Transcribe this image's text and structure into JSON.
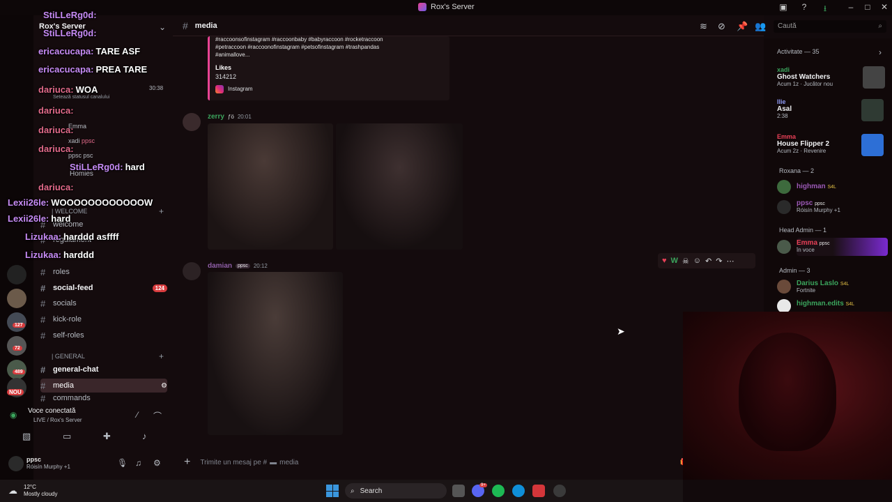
{
  "window": {
    "title": "Rox's Server"
  },
  "server": {
    "name": "Rox's Server"
  },
  "server_badges": [
    "127",
    "72",
    "489",
    "NOU"
  ],
  "channel_status_hint": "Setează statusul canalului",
  "stream_time": "30:38",
  "stream_overlay": [
    {
      "name": "StiLLeRg0d:",
      "text": "",
      "badge": "1"
    },
    {
      "name": "StiLLeRg0d:",
      "text": "",
      "badge": "1"
    },
    {
      "name": "ericacucapa:",
      "text": "TARE ASF"
    },
    {
      "name": "ericacucapa:",
      "text": "PREA TARE"
    },
    {
      "name": "dariuca:",
      "text": "WOA"
    },
    {
      "name": "dariuca:",
      "text": ""
    },
    {
      "name": "dariuca:",
      "text": ""
    },
    {
      "name": "dariuca:",
      "text": ""
    },
    {
      "name": "StiLLeRg0d:",
      "text": "hard",
      "badge": "1"
    },
    {
      "name": "dariuca:",
      "text": ""
    },
    {
      "name": "Lexii26le:",
      "text": "WOOOOOOOOOOOOW"
    },
    {
      "name": "Lexii26le:",
      "text": "hard"
    },
    {
      "name": "Lizukaa:",
      "text": "harddd asffff"
    },
    {
      "name": "Lizukaa:",
      "text": "harddd"
    }
  ],
  "voice_users": [
    {
      "name": "Emma"
    },
    {
      "name": "xadi",
      "tag": "ppsc"
    },
    {
      "name": "ppsc",
      "tag": "psc"
    }
  ],
  "categories": {
    "welcome": "| WELCOME",
    "general": "| GENERAL",
    "homies": "Homies"
  },
  "channels": [
    {
      "name": "welcome"
    },
    {
      "name": "regulament"
    },
    {
      "name": "roles"
    },
    {
      "name": "social-feed",
      "badge": "124"
    },
    {
      "name": "socials"
    },
    {
      "name": "kick-role"
    },
    {
      "name": "self-roles"
    },
    {
      "name": "general-chat"
    },
    {
      "name": "media"
    },
    {
      "name": "commands"
    }
  ],
  "voice_panel": {
    "status": "Voce conectată",
    "sub": "LIVE / Rox's Server"
  },
  "user_panel": {
    "name": "ppsc",
    "status": "Róisín Murphy +1"
  },
  "header": {
    "channel": "media",
    "search_placeholder": "Caută"
  },
  "embed": {
    "hashtags_1": "#raccoonsofinstagram #raccoonbaby #babyraccoon #rocketraccoon",
    "hashtags_2": "#petraccoon #raccoonofinstagram #petsofinstagram #trashpandas",
    "hashtags_3": "#animallove...",
    "likes_label": "Likes",
    "likes_value": "314212",
    "source": "Instagram"
  },
  "messages": [
    {
      "author": "zerry",
      "badge": "ƒö",
      "time": "20:01"
    },
    {
      "author": "damian",
      "tag": "ppsc",
      "time": "20:12"
    }
  ],
  "composer": {
    "placeholder": "Trimite un mesaj pe #",
    "channel": "media"
  },
  "members": {
    "activity_header": "Activitate — 35",
    "activity": [
      {
        "name": "xadi",
        "game": "Ghost Watchers",
        "detail": "Acum 1z",
        "extra": "Jucător nou"
      },
      {
        "name": "Ilie",
        "game": "Asal",
        "detail": "2:38"
      },
      {
        "name": "Emma",
        "game": "House Flipper 2",
        "detail": "Acum 2z",
        "extra": "Revenire"
      }
    ],
    "roxana_header": "Roxana — 2",
    "roxana": [
      {
        "name": "highman",
        "tag": "S4L"
      },
      {
        "name": "ppsc",
        "tag": "ppsc",
        "status": "Róisín Murphy +1"
      }
    ],
    "head_admin_header": "Head Admin — 1",
    "head_admin": [
      {
        "name": "Emma",
        "tag": "ppsc",
        "status": "în voce"
      }
    ],
    "admin_header": "Admin — 3",
    "admin": [
      {
        "name": "Darius Laslo",
        "tag": "S4L",
        "status": "Fortnite"
      },
      {
        "name": "highman.edits",
        "tag": "S4L"
      }
    ]
  },
  "taskbar": {
    "weather_temp": "12°C",
    "weather_text": "Mostly cloudy",
    "search": "Search",
    "discord_badge": "9+"
  },
  "colors": {
    "accent": "#3ba55d",
    "mention": "#d83c3e",
    "bg": "#140b0d"
  }
}
